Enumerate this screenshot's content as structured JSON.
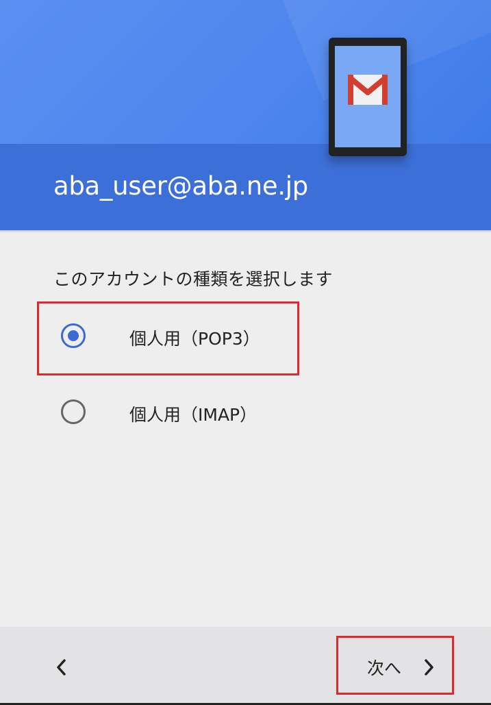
{
  "header": {
    "account_email": "aba_user@aba.ne.jp",
    "illustration": "phone-with-gmail-icon"
  },
  "main": {
    "prompt": "このアカウントの種類を選択します",
    "options": [
      {
        "label": "個人用（POP3）",
        "selected": true
      },
      {
        "label": "個人用（IMAP）",
        "selected": false
      }
    ]
  },
  "footer": {
    "back_icon": "chevron-left-icon",
    "next_label": "次へ",
    "next_icon": "chevron-right-icon"
  },
  "colors": {
    "header_blue": "#3d6fd8",
    "accent": "#3a6ad4",
    "highlight_red": "#e0282f",
    "background": "#eeeeee"
  }
}
